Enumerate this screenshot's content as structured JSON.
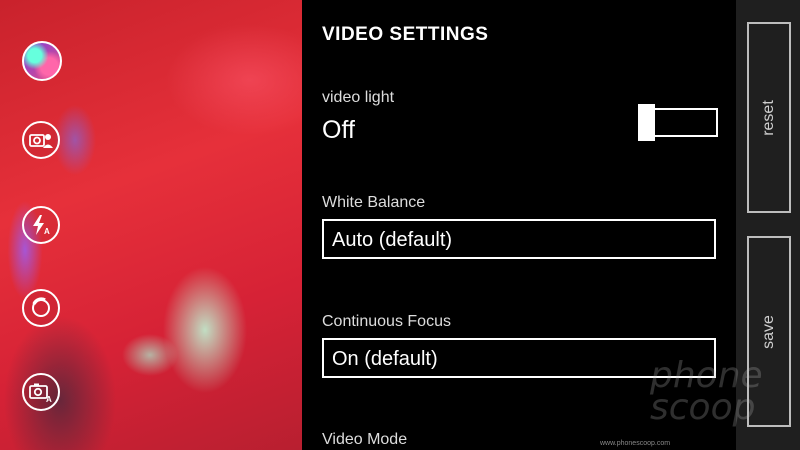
{
  "panel": {
    "title": "VIDEO SETTINGS",
    "video_light": {
      "label": "video light",
      "value": "Off"
    },
    "white_balance": {
      "label": "White Balance",
      "value": "Auto (default)"
    },
    "continuous_focus": {
      "label": "Continuous Focus",
      "value": "On (default)"
    },
    "video_mode": {
      "label": "Video Mode"
    }
  },
  "appbar": {
    "reset_label": "reset",
    "save_label": "save"
  },
  "watermark": {
    "text": "phone scoop",
    "url": "www.phonescoop.com"
  },
  "side_tools": [
    "lens-icon",
    "front-camera-icon",
    "flash-auto-icon",
    "stabilization-icon",
    "camera-scene-icon"
  ]
}
